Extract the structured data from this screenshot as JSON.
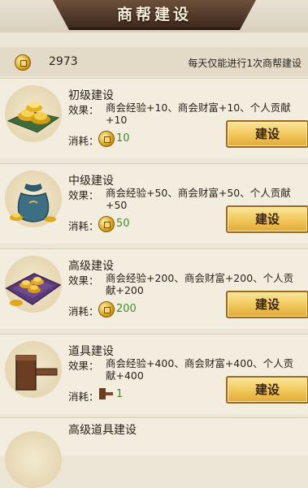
{
  "header": {
    "title": "商帮建设"
  },
  "topbar": {
    "balance": "2973",
    "notice": "每天仅能进行1次商帮建设"
  },
  "items": [
    {
      "title": "初级建设",
      "effect_label": "效果：",
      "effect": "商会经验+10、商会财富+10、个人贡献+10",
      "cost_label": "消耗：",
      "cost": "10",
      "button": "建设",
      "icon": "gold-ingots-on-cloth-icon"
    },
    {
      "title": "中级建设",
      "effect_label": "效果：",
      "effect": "商会经验+50、商会财富+50、个人贡献+50",
      "cost_label": "消耗：",
      "cost": "50",
      "button": "建设",
      "icon": "money-bag-icon"
    },
    {
      "title": "高级建设",
      "effect_label": "效果：",
      "effect": "商会经验+200、商会财富+200、个人贡献+200",
      "cost_label": "消耗：",
      "cost": "200",
      "button": "建设",
      "icon": "treasure-box-icon"
    },
    {
      "title": "道具建设",
      "effect_label": "效果：",
      "effect": "商会经验+400、商会财富+400、个人贡献+400",
      "cost_label": "消耗：",
      "cost": "1",
      "button": "建设",
      "icon": "wooden-hammer-icon"
    },
    {
      "title": "高级道具建设"
    }
  ],
  "colors": {
    "cost_text": "#3d8f2a",
    "button": "#f0c658",
    "banner": "#4f3727"
  }
}
